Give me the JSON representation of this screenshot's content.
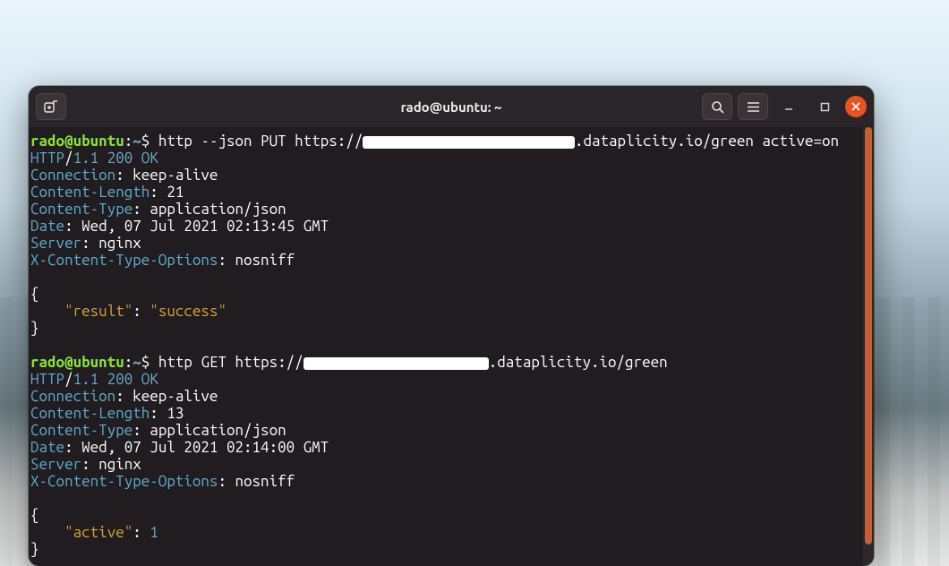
{
  "window": {
    "title": "rado@ubuntu: ~"
  },
  "icons": {
    "new_tab": "new-tab-icon",
    "search": "search-icon",
    "menu": "hamburger-icon",
    "minimize": "minimize-icon",
    "maximize": "maximize-icon",
    "close": "close-icon"
  },
  "prompt": {
    "user_host": "rado@ubuntu",
    "sep": ":",
    "cwd": "~",
    "symbol": "$"
  },
  "sessions": [
    {
      "command": "http --json PUT https://██████████████.dataplicity.io/green active=on",
      "redaction_ch_width": 24,
      "status": {
        "proto": "HTTP",
        "ver": "1.1",
        "code": "200 OK"
      },
      "headers": [
        {
          "k": "Connection",
          "v": "keep-alive"
        },
        {
          "k": "Content-Length",
          "v": "21"
        },
        {
          "k": "Content-Type",
          "v": "application/json"
        },
        {
          "k": "Date",
          "v": "Wed, 07 Jul 2021 02:13:45 GMT"
        },
        {
          "k": "Server",
          "v": "nginx"
        },
        {
          "k": "X-Content-Type-Options",
          "v": "nosniff"
        }
      ],
      "json_lines": [
        {
          "brace": "{"
        },
        {
          "indent": 4,
          "key": "\"result\"",
          "val": "\"success\"",
          "val_type": "string"
        },
        {
          "brace": "}"
        }
      ]
    },
    {
      "command": "http GET https://████████████.dataplicity.io/green",
      "redaction_ch_width": 21,
      "status": {
        "proto": "HTTP",
        "ver": "1.1",
        "code": "200 OK"
      },
      "headers": [
        {
          "k": "Connection",
          "v": "keep-alive"
        },
        {
          "k": "Content-Length",
          "v": "13"
        },
        {
          "k": "Content-Type",
          "v": "application/json"
        },
        {
          "k": "Date",
          "v": "Wed, 07 Jul 2021 02:14:00 GMT"
        },
        {
          "k": "Server",
          "v": "nginx"
        },
        {
          "k": "X-Content-Type-Options",
          "v": "nosniff"
        }
      ],
      "json_lines": [
        {
          "brace": "{"
        },
        {
          "indent": 4,
          "key": "\"active\"",
          "val": "1",
          "val_type": "number"
        },
        {
          "brace": "}"
        }
      ]
    }
  ]
}
